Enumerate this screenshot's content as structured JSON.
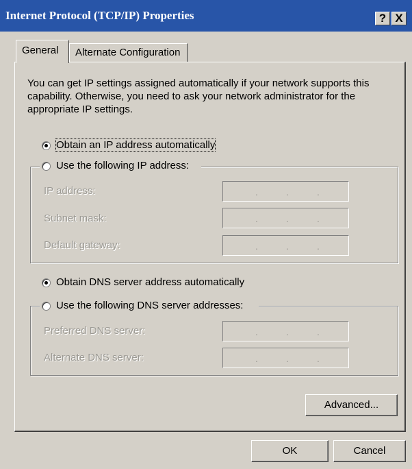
{
  "window": {
    "title": "Internet Protocol (TCP/IP) Properties",
    "help_label": "?",
    "close_label": "X"
  },
  "tabs": [
    {
      "label": "General",
      "active": true
    },
    {
      "label": "Alternate Configuration",
      "active": false
    }
  ],
  "description": "You can get IP settings assigned automatically if your network supports this capability. Otherwise, you need to ask your network administrator for the appropriate IP settings.",
  "ip_options": {
    "auto": {
      "label": "Obtain an IP address automatically",
      "selected": true
    },
    "manual": {
      "label": "Use the following IP address:",
      "selected": false
    }
  },
  "ip_fields": [
    {
      "label": "IP address:",
      "value": ". . ."
    },
    {
      "label": "Subnet mask:",
      "value": ". . ."
    },
    {
      "label": "Default gateway:",
      "value": ". . ."
    }
  ],
  "dns_options": {
    "auto": {
      "label": "Obtain DNS server address automatically",
      "selected": true
    },
    "manual": {
      "label": "Use the following DNS server addresses:",
      "selected": false
    }
  },
  "dns_fields": [
    {
      "label": "Preferred DNS server:",
      "value": ". . ."
    },
    {
      "label": "Alternate DNS server:",
      "value": ". . ."
    }
  ],
  "buttons": {
    "advanced": "Advanced...",
    "ok": "OK",
    "cancel": "Cancel"
  },
  "colors": {
    "titlebar": "#2855a8",
    "face": "#d4d0c8",
    "disabled_text": "#9c9a94"
  }
}
